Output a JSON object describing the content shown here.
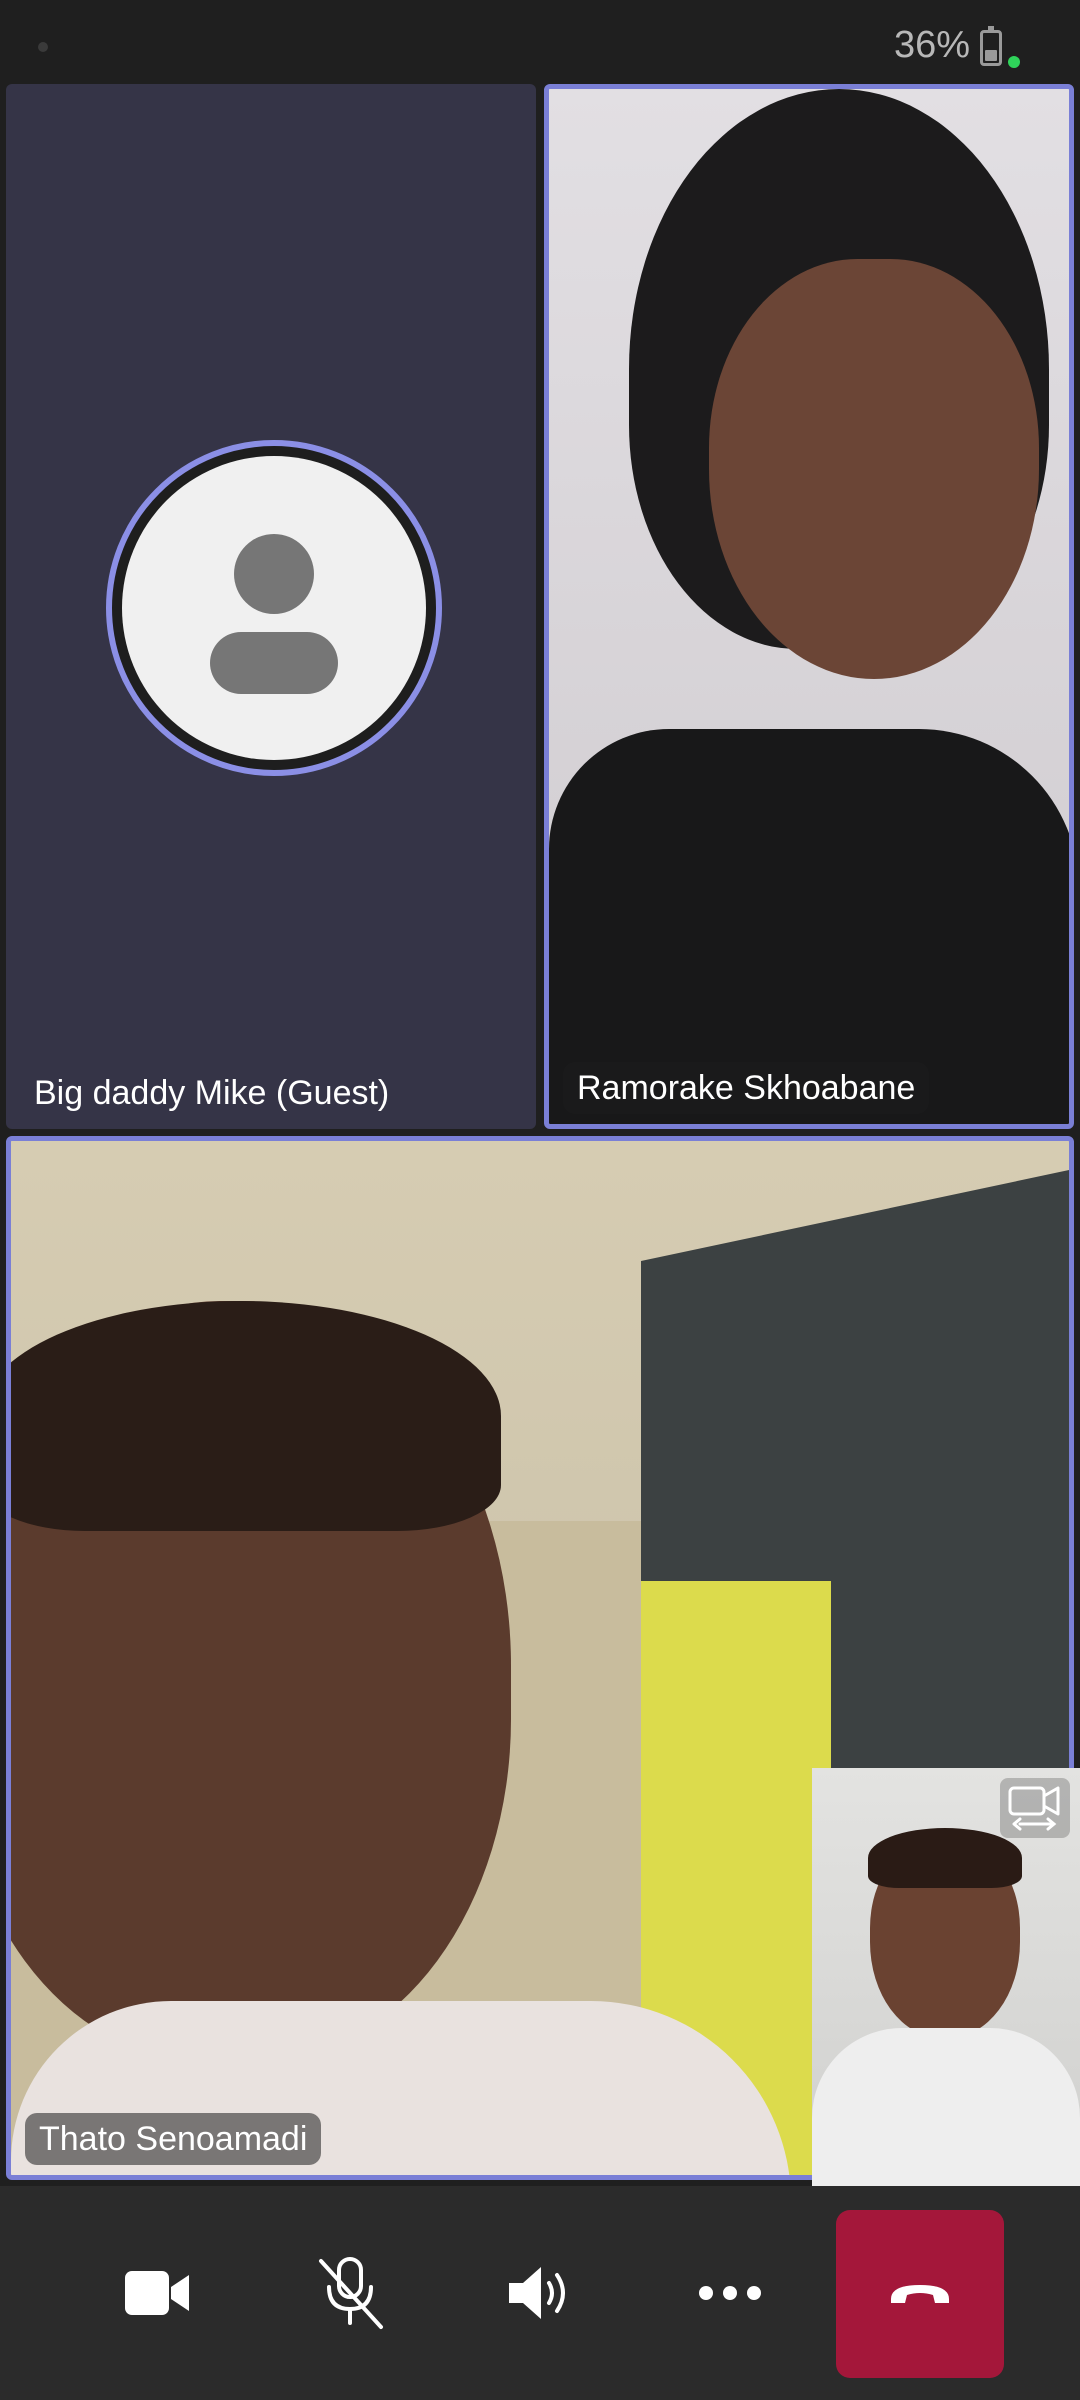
{
  "status_bar": {
    "battery_percent": "36%",
    "battery_level": 0.36
  },
  "participants": [
    {
      "name": "Big daddy Mike (Guest)",
      "video": false,
      "avatar_icon": "person-icon"
    },
    {
      "name": "Ramorake Skhoabane",
      "video": true,
      "active_speaker": true
    },
    {
      "name": "Thato Senoamadi",
      "video": true,
      "active_speaker": true
    }
  ],
  "self_view": {
    "switch_camera_icon": "switch-camera-icon"
  },
  "controls": {
    "video_icon": "video-camera-icon",
    "mic_icon": "microphone-muted-icon",
    "speaker_icon": "speaker-icon",
    "more_icon": "more-options-icon",
    "hangup_icon": "hang-up-icon"
  },
  "colors": {
    "active_border": "#7a7fd6",
    "hangup": "#a4173a",
    "control_bar": "#2b2b2b",
    "guest_tile": "#353447"
  }
}
